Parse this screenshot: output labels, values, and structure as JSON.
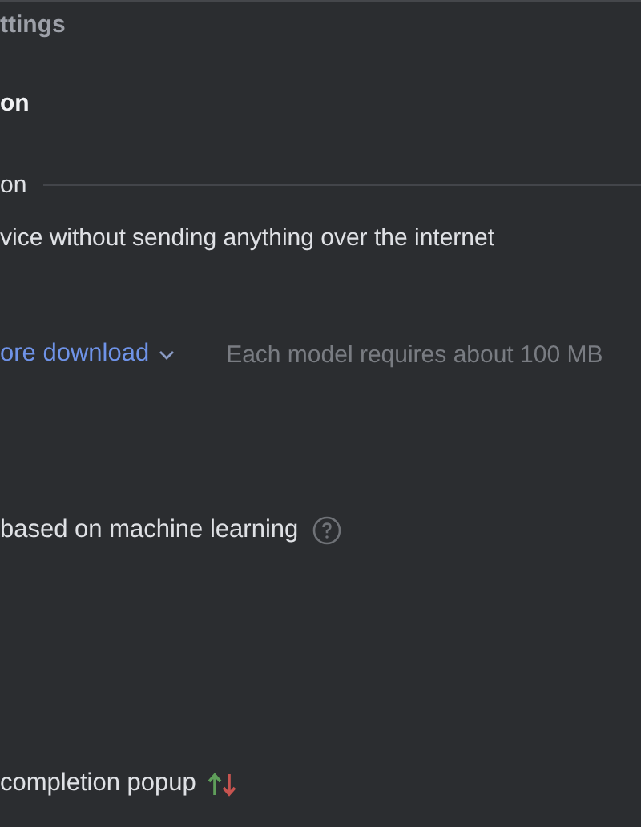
{
  "page_title": "ttings",
  "section_title": "on",
  "group": {
    "title": "on",
    "description": "vice without sending anything over the internet"
  },
  "download": {
    "link": "ore download",
    "note": "Each model requires about 100 MB"
  },
  "ml_option": {
    "label": "based on machine learning"
  },
  "popup_option": {
    "label": "completion popup"
  }
}
